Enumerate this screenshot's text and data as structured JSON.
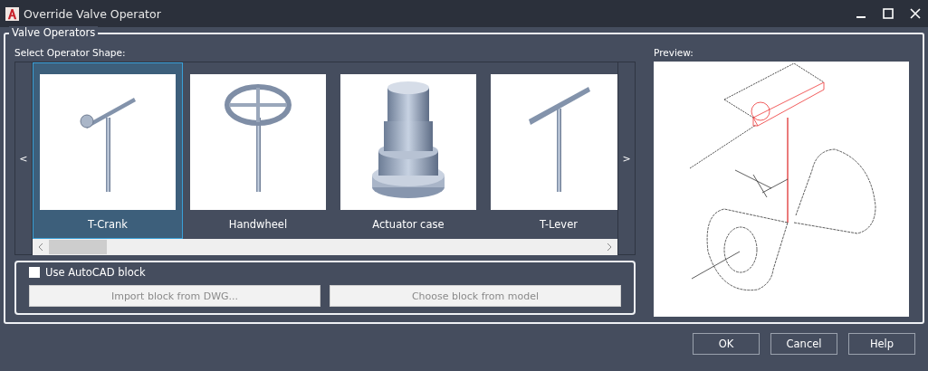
{
  "window": {
    "title": "Override Valve Operator"
  },
  "group": {
    "title": "Valve Operators"
  },
  "gallery": {
    "label": "Select Operator Shape:",
    "prev": "<",
    "next": ">",
    "items": [
      {
        "kind": "t-crank",
        "label": "T-Crank",
        "selected": true
      },
      {
        "kind": "handwheel",
        "label": "Handwheel",
        "selected": false
      },
      {
        "kind": "actuator",
        "label": "Actuator case",
        "selected": false
      },
      {
        "kind": "t-lever",
        "label": "T-Lever",
        "selected": false
      }
    ]
  },
  "block": {
    "checkbox": {
      "label": "Use AutoCAD block",
      "checked": false
    },
    "buttons": [
      {
        "label": "Import block from DWG...",
        "disabled": true
      },
      {
        "label": "Choose block from model",
        "disabled": true
      }
    ]
  },
  "preview": {
    "label": "Preview:"
  },
  "buttons": [
    "OK",
    "Cancel",
    "Help"
  ]
}
